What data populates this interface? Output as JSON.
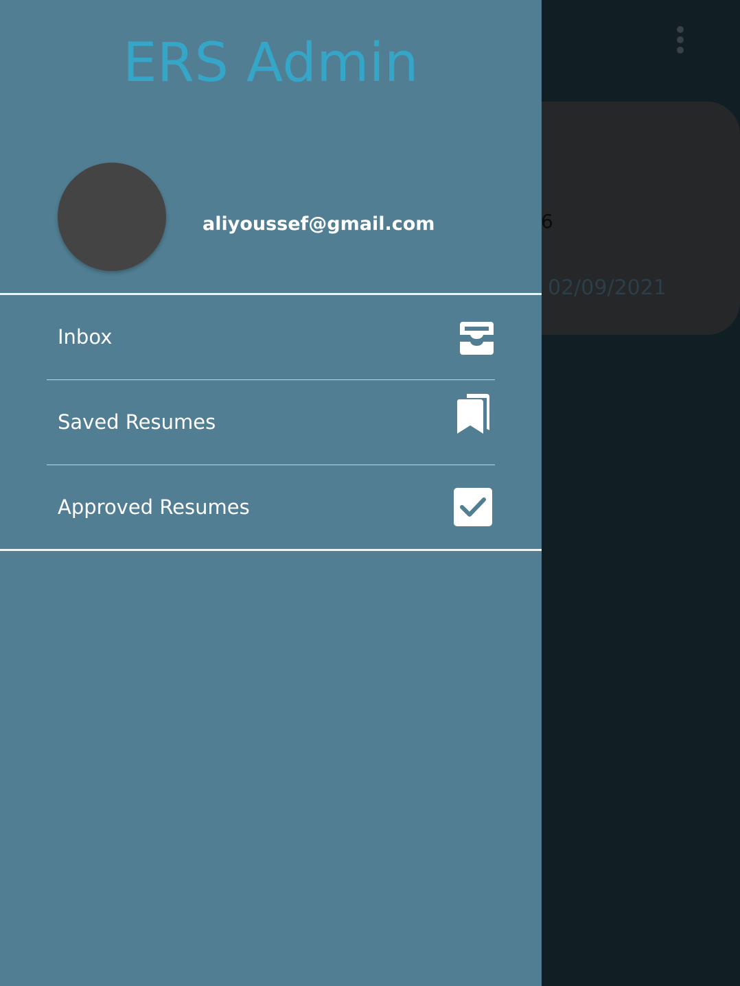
{
  "background": {
    "card": {
      "count_fragment": "6",
      "date": "02/09/2021"
    },
    "overflow_icon": "more-vert-icon"
  },
  "drawer": {
    "title": "ERS Admin",
    "user": {
      "email": "aliyoussef@gmail.com"
    },
    "items": [
      {
        "label": "Inbox",
        "icon": "inbox-tray-icon"
      },
      {
        "label": "Saved Resumes",
        "icon": "bookmarks-icon"
      },
      {
        "label": "Approved Resumes",
        "icon": "checkbox-checked-icon"
      }
    ]
  },
  "colors": {
    "drawer_background": "#517e92",
    "title": "#35a6c8",
    "scrim": "#111f24",
    "avatar": "#444444"
  }
}
